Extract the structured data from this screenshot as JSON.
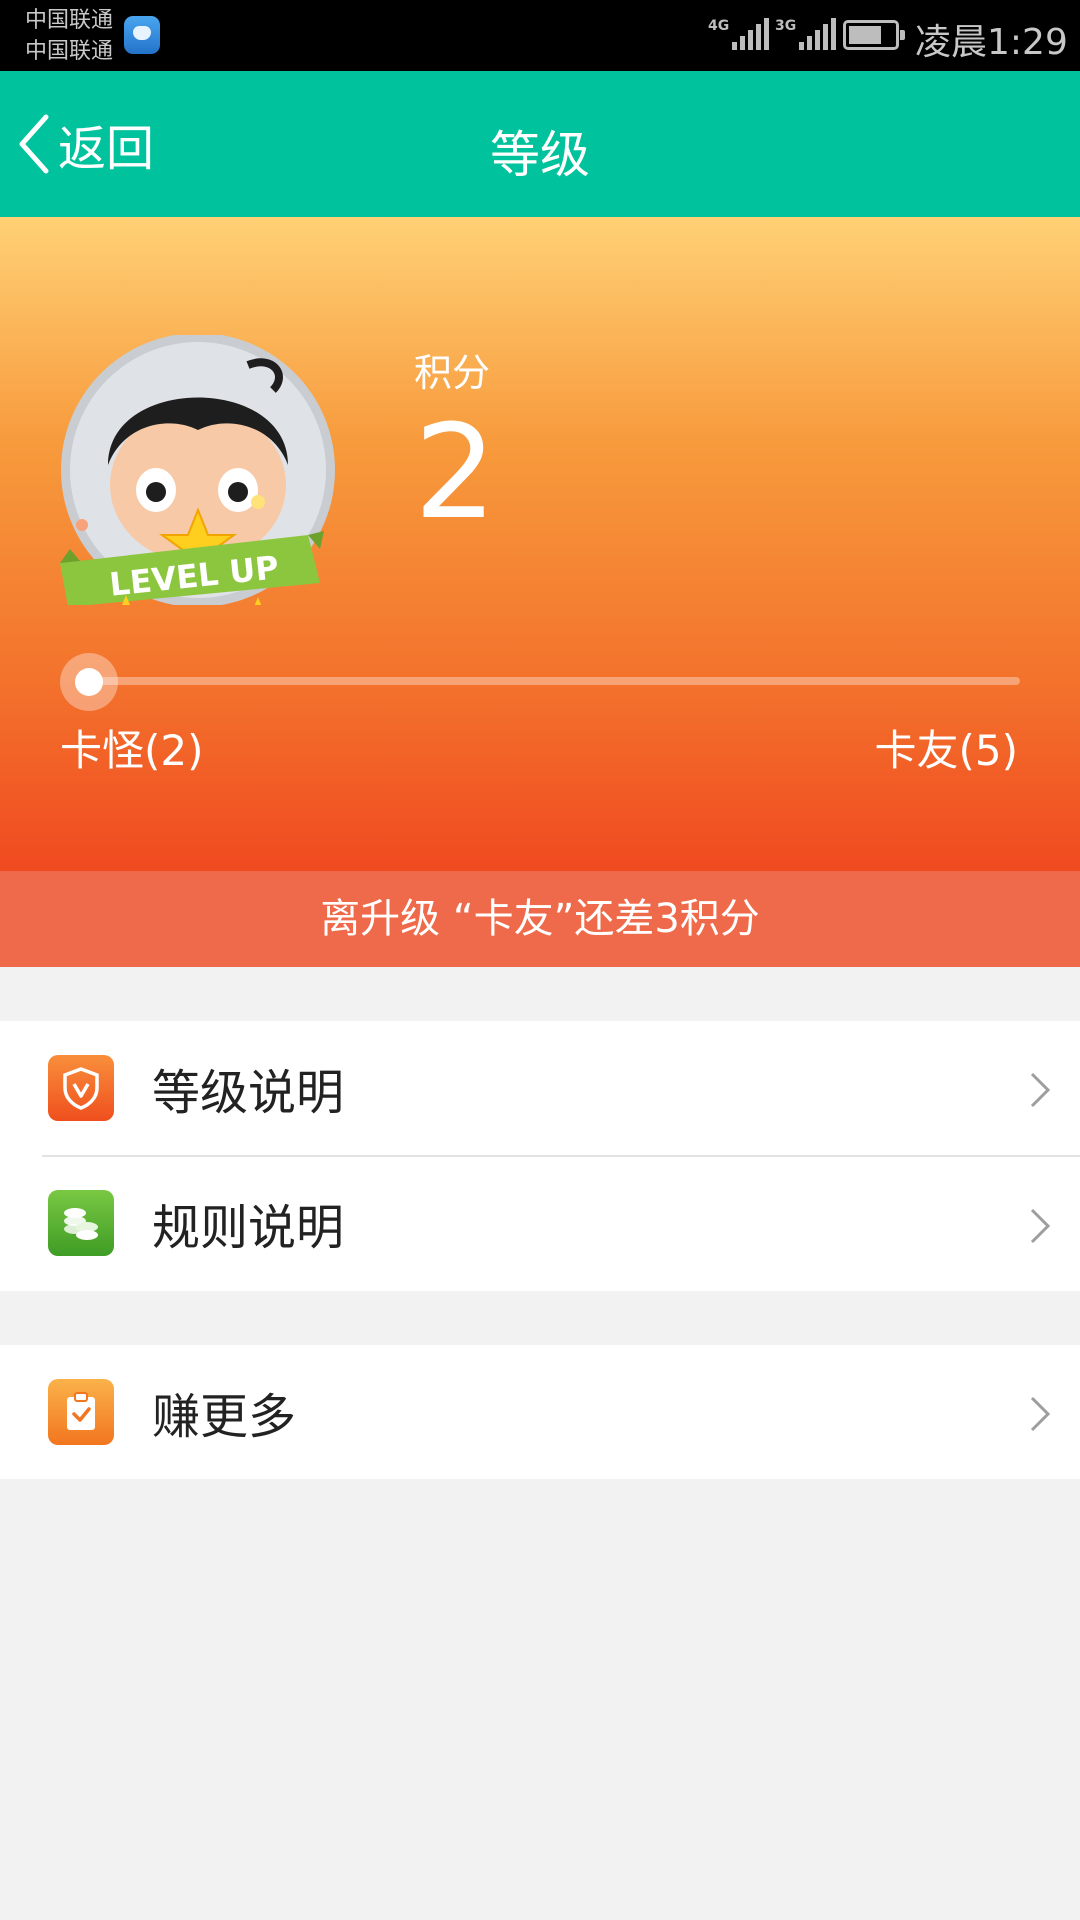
{
  "status_bar": {
    "carrier_1": "中国联通",
    "carrier_2": "中国联通",
    "network_1": "4G",
    "network_2": "3G",
    "time": "凌晨1:29"
  },
  "header": {
    "back_label": "返回",
    "title": "等级"
  },
  "hero": {
    "points_label": "积分",
    "points_value": "2",
    "badge_text": "LEVEL UP",
    "current_level": "卡怪(2)",
    "next_level": "卡友(5)",
    "progress_fraction": 0
  },
  "notice": "离升级 “卡友”还差3积分",
  "menu": {
    "group_1": [
      {
        "label": "等级说明",
        "icon": "shield-icon"
      },
      {
        "label": "规则说明",
        "icon": "coins-icon"
      }
    ],
    "group_2": [
      {
        "label": "赚更多",
        "icon": "clipboard-check-icon"
      }
    ]
  },
  "colors": {
    "header": "#00c29c",
    "notice": "#ef6a4a",
    "hero_top": "#ffd075",
    "hero_bottom": "#f04a20"
  }
}
